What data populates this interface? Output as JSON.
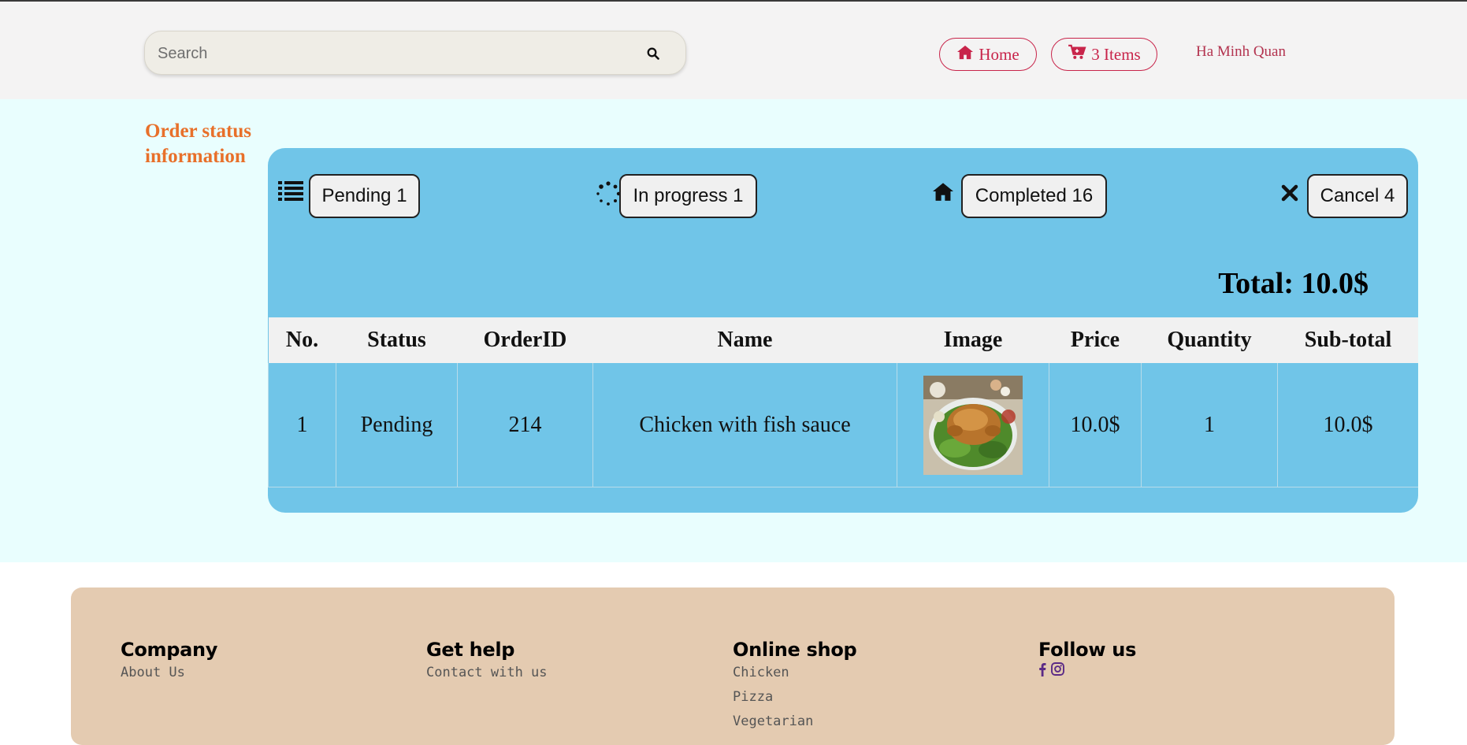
{
  "header": {
    "search_placeholder": "Search",
    "icons": {
      "search": "search-icon",
      "home": "home-icon",
      "cart": "cart-icon"
    },
    "home_label": "Home",
    "cart_label": "3 Items",
    "user_name": "Ha Minh Quan"
  },
  "sidebar": {
    "title": "Order status information"
  },
  "status_bar": [
    {
      "icon": "list-icon",
      "label": "Pending 1"
    },
    {
      "icon": "spinner-icon",
      "label": "In progress 1"
    },
    {
      "icon": "home-icon",
      "label": "Completed 16"
    },
    {
      "icon": "close-icon",
      "label": "Cancel 4"
    }
  ],
  "total_label": "Total: 10.0$",
  "table": {
    "columns": [
      "No.",
      "Status",
      "OrderID",
      "Name",
      "Image",
      "Price",
      "Quantity",
      "Sub-total"
    ],
    "rows": [
      {
        "no": "1",
        "status": "Pending",
        "order_id": "214",
        "name": "Chicken with fish sauce",
        "image": "roast-chicken-image",
        "price": "10.0$",
        "quantity": "1",
        "subtotal": "10.0$"
      }
    ]
  },
  "footer": {
    "columns": [
      {
        "title": "Company",
        "links": [
          "About Us"
        ]
      },
      {
        "title": "Get help",
        "links": [
          "Contact with us"
        ]
      },
      {
        "title": "Online shop",
        "links": [
          "Chicken",
          "Pizza",
          "Vegetarian"
        ]
      },
      {
        "title": "Follow us",
        "social": [
          "facebook-icon",
          "instagram-icon"
        ]
      }
    ]
  },
  "colors": {
    "accent_red": "#c8244a",
    "title_orange": "#e8702a",
    "panel_blue": "#70c5e8",
    "page_bg": "#e9fefe",
    "footer_bg": "#e4cbb1",
    "social_purple": "#5b2a86"
  }
}
